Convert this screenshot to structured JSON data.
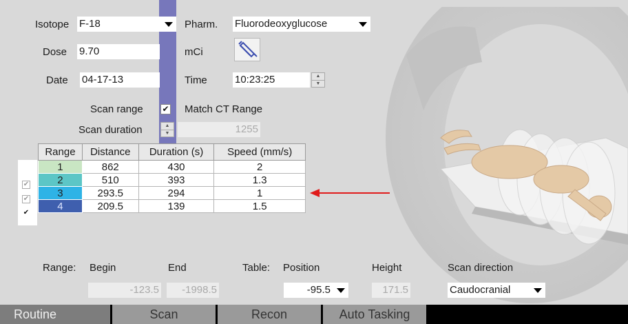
{
  "params": {
    "isotope_label": "Isotope",
    "isotope_value": "F-18",
    "pharm_label": "Pharm.",
    "pharm_value": "Fluorodeoxyglucose",
    "dose_label": "Dose",
    "dose_value": "9.70",
    "dose_unit": "mCi",
    "date_label": "Date",
    "date_value": "04-17-13",
    "time_label": "Time",
    "time_value": "10:23:25",
    "scan_range_label": "Scan range",
    "match_ct_label": "Match CT Range",
    "match_ct_checked": true,
    "scan_duration_label": "Scan duration",
    "scan_duration_value": "1255"
  },
  "range_table": {
    "headers": [
      "Range",
      "Distance",
      "Duration (s)",
      "Speed (mm/s)"
    ],
    "rows": [
      {
        "range": "1",
        "distance": "862",
        "duration": "430",
        "speed": "2",
        "color": "#c9e6c3",
        "checked": false
      },
      {
        "range": "2",
        "distance": "510",
        "duration": "393",
        "speed": "1.3",
        "color": "#5cc6c6",
        "checked": true
      },
      {
        "range": "3",
        "distance": "293.5",
        "duration": "294",
        "speed": "1",
        "color": "#2eb3e6",
        "checked": true
      },
      {
        "range": "4",
        "distance": "209.5",
        "duration": "139",
        "speed": "1.5",
        "color": "#3f5fae",
        "checked": true
      }
    ]
  },
  "range_fields": {
    "range_label": "Range:",
    "begin_label": "Begin",
    "end_label": "End",
    "begin_value": "-123.5",
    "end_value": "-1998.5",
    "table_label": "Table:",
    "position_label": "Position",
    "position_value": "-95.5",
    "height_label": "Height",
    "height_value": "171.5",
    "scan_direction_label": "Scan direction",
    "scan_direction_value": "Caudocranial"
  },
  "tabs": [
    {
      "label": "Routine",
      "active": true
    },
    {
      "label": "Scan",
      "active": false
    },
    {
      "label": "Recon",
      "active": false
    },
    {
      "label": "Auto Tasking",
      "active": false
    }
  ],
  "colors": {
    "accent_bar": "#7777bb",
    "arrow": "#e01b1b"
  },
  "icons": {
    "syringe": "syringe-icon"
  }
}
